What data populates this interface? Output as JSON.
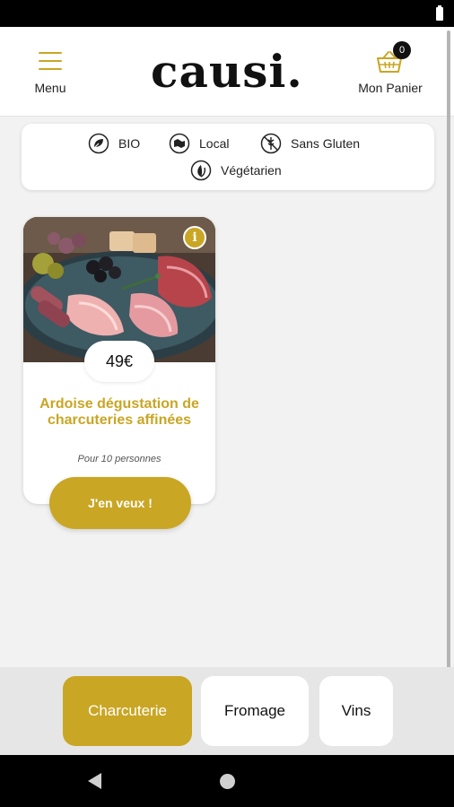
{
  "header": {
    "menu_label": "Menu",
    "logo": "causi.",
    "cart_label": "Mon Panier",
    "cart_count": "0"
  },
  "filters": [
    {
      "label": "BIO",
      "icon": "bio-leaf-icon"
    },
    {
      "label": "Local",
      "icon": "local-map-icon"
    },
    {
      "label": "Sans Gluten",
      "icon": "gluten-free-icon"
    },
    {
      "label": "Végétarien",
      "icon": "vegetarian-leaf-icon"
    }
  ],
  "product": {
    "price": "49€",
    "name": "Ardoise dégustation de charcuteries affinées",
    "serving": "Pour 10 personnes",
    "cta": "J'en veux !",
    "info_icon": "info-icon"
  },
  "tabs": [
    {
      "label": "Charcuterie",
      "active": true
    },
    {
      "label": "Fromage",
      "active": false
    },
    {
      "label": "Vins",
      "active": false
    }
  ],
  "colors": {
    "accent": "#c9a624",
    "background": "#f2f2f2",
    "text": "#111111"
  }
}
